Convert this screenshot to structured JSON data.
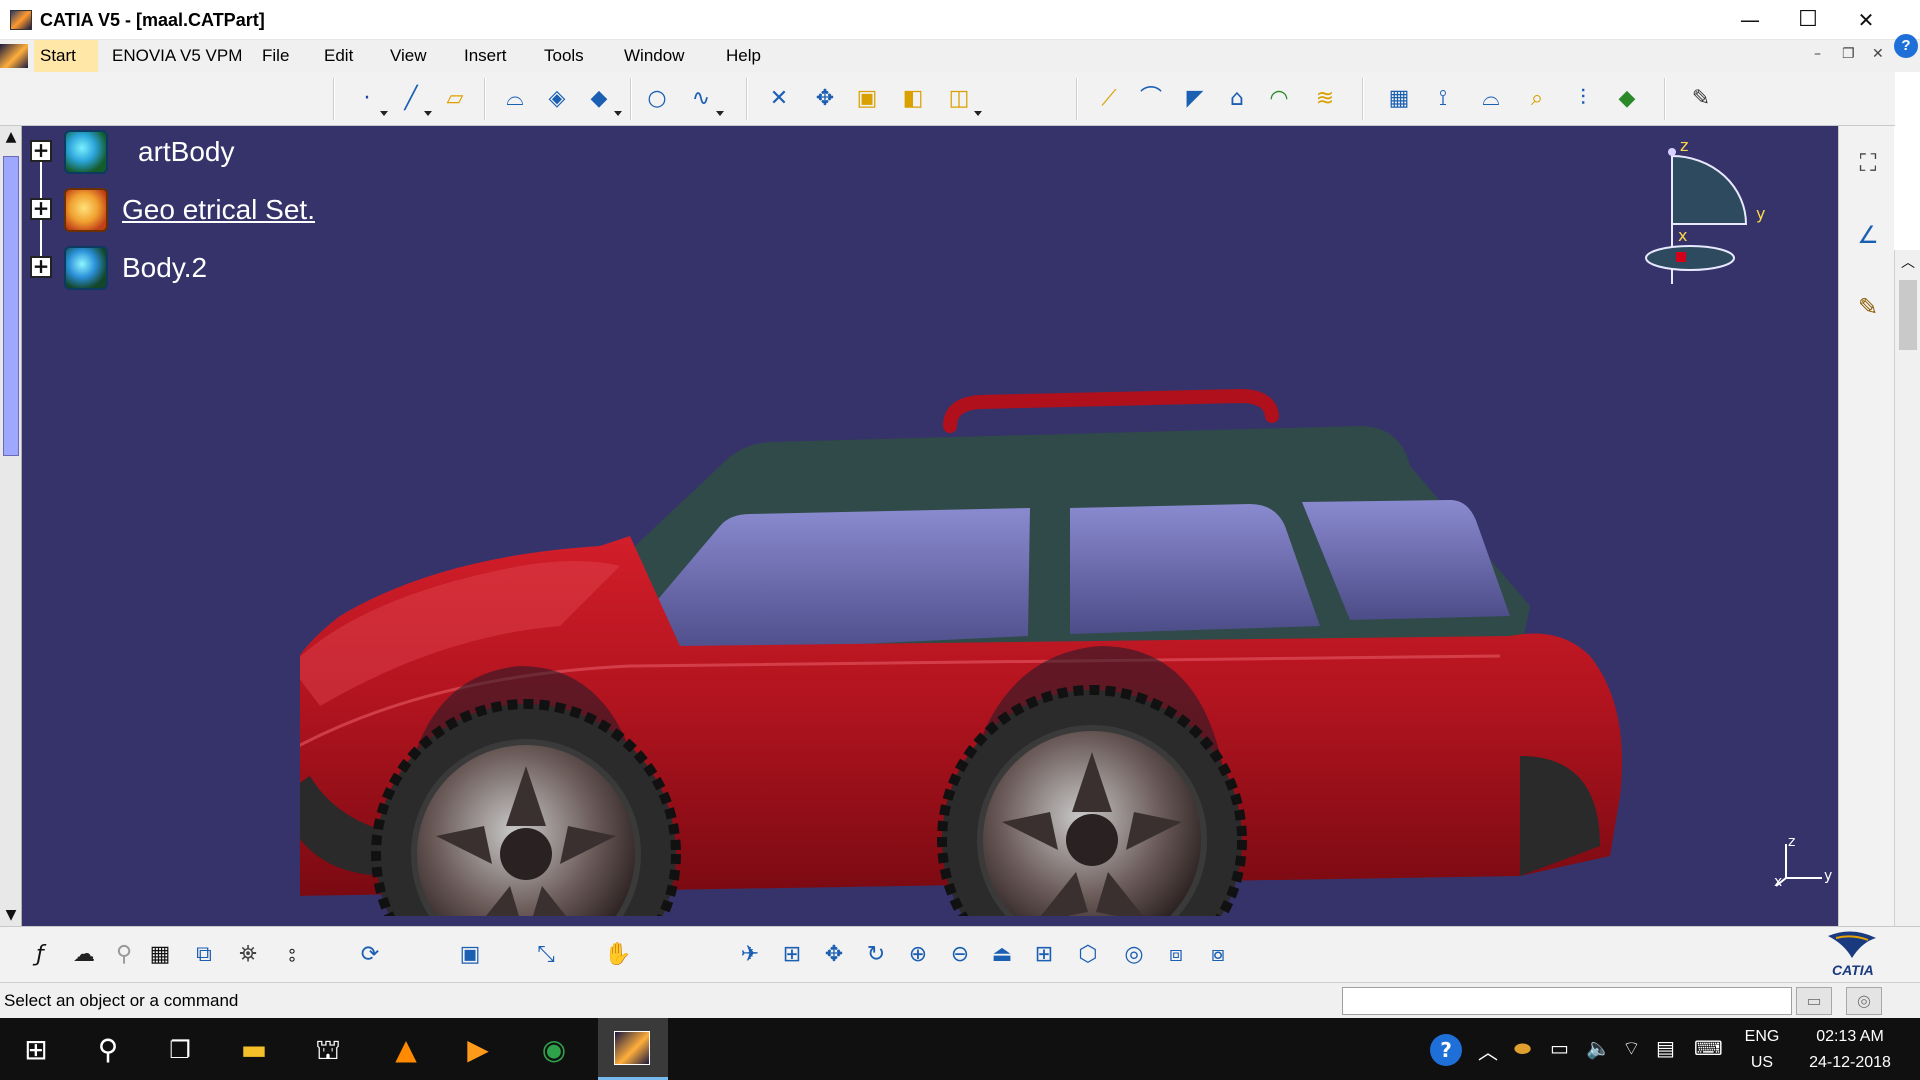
{
  "window": {
    "title": "CATIA V5 - [maal.CATPart]",
    "minimize": "—",
    "maximize": "☐",
    "close": "✕"
  },
  "menubar": {
    "items": [
      {
        "label": "Start"
      },
      {
        "label": "ENOVIA V5 VPM"
      },
      {
        "label": "File"
      },
      {
        "label": "Edit"
      },
      {
        "label": "View"
      },
      {
        "label": "Insert"
      },
      {
        "label": "Tools"
      },
      {
        "label": "Window"
      },
      {
        "label": "Help"
      }
    ],
    "mdi_minimize": "–",
    "mdi_restore": "❐",
    "mdi_close": "✕",
    "help_badge": "?"
  },
  "tree": {
    "nodes": [
      {
        "label": "artBody",
        "icon": "part-body-icon"
      },
      {
        "label": "Geo   etrical Set.",
        "icon": "geometrical-set-icon"
      },
      {
        "label": "Body.2",
        "icon": "body-icon"
      }
    ]
  },
  "compass": {
    "z": "z",
    "y": "y",
    "x": "x"
  },
  "mini_axes": {
    "z": "z",
    "y": "y",
    "x": "x"
  },
  "brand": {
    "label": "CATIA"
  },
  "status": {
    "text": "Select an object or a command",
    "command_input_value": ""
  },
  "taskbar": {
    "lang_line1": "ENG",
    "lang_line2": "US",
    "time": "02:13 AM",
    "date": "24-12-2018"
  },
  "colors": {
    "viewport_bg": "#36336a",
    "car_body": "#b2141f",
    "glass": "#5e5f9a",
    "roof": "#2f4a48",
    "tree_text": "#ffffff"
  }
}
